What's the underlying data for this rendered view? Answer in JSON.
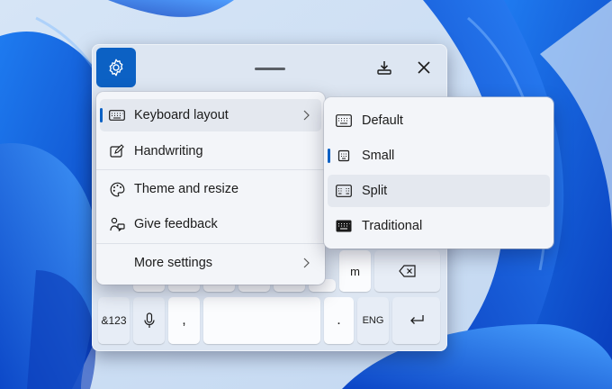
{
  "menu": {
    "items": [
      {
        "label": "Keyboard layout",
        "icon": "keyboard-icon",
        "has_submenu": true,
        "selected": true
      },
      {
        "label": "Handwriting",
        "icon": "pen-icon"
      },
      {
        "label": "Theme and resize",
        "icon": "palette-icon"
      },
      {
        "label": "Give feedback",
        "icon": "feedback-icon"
      },
      {
        "label": "More settings",
        "icon": "",
        "has_submenu": true
      }
    ]
  },
  "submenu": {
    "items": [
      {
        "label": "Default",
        "icon": "keyboard-default-icon"
      },
      {
        "label": "Small",
        "icon": "keyboard-small-icon",
        "selected": true
      },
      {
        "label": "Split",
        "icon": "keyboard-split-icon"
      },
      {
        "label": "Traditional",
        "icon": "keyboard-traditional-icon"
      }
    ]
  },
  "keyboard": {
    "keys_row3": {
      "m": "m"
    },
    "bottom_row": {
      "numbers": "&123",
      "comma": ",",
      "period": ".",
      "language": "ENG"
    }
  },
  "colors": {
    "accent": "#0c61c4",
    "wallpaper_bg": "#cfe0f5",
    "wallpaper_blue": "#0a56d8"
  }
}
